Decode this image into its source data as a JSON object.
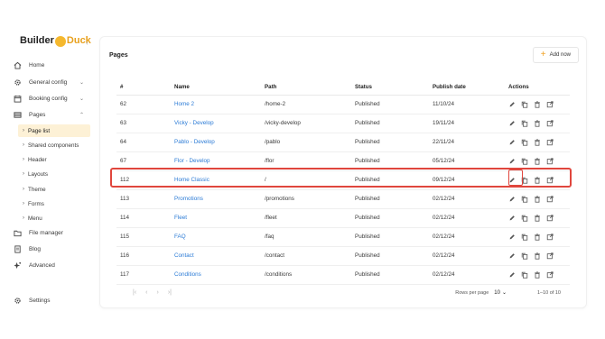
{
  "sidebar": {
    "logo_left": "Builder",
    "logo_right": "Duck",
    "collapse_glyph": "‹",
    "items": [
      {
        "label": "Home",
        "icon": "home-icon"
      },
      {
        "label": "General config",
        "icon": "gear-icon",
        "chevron": "⌄"
      },
      {
        "label": "Booking config",
        "icon": "calendar-icon",
        "chevron": "⌄"
      },
      {
        "label": "Pages",
        "icon": "pages-icon",
        "chevron": "⌃"
      }
    ],
    "sub_items": [
      {
        "label": "Page list",
        "active": true
      },
      {
        "label": "Shared components"
      },
      {
        "label": "Header"
      },
      {
        "label": "Layouts"
      },
      {
        "label": "Theme"
      },
      {
        "label": "Forms"
      },
      {
        "label": "Menu"
      }
    ],
    "bottom_items": [
      {
        "label": "File manager",
        "icon": "folder-icon"
      },
      {
        "label": "Blog",
        "icon": "document-icon"
      },
      {
        "label": "Advanced",
        "icon": "sparkle-icon"
      }
    ],
    "settings_label": "Settings",
    "sub_arrow": "›"
  },
  "main": {
    "title": "Pages",
    "add_button": "Add now",
    "add_plus": "+",
    "columns": [
      "#",
      "Name",
      "Path",
      "Status",
      "Publish date",
      "Actions"
    ],
    "rows": [
      {
        "id": "62",
        "name": "Home 2",
        "path": "/home-2",
        "status": "Published",
        "date": "11/10/24"
      },
      {
        "id": "63",
        "name": "Vicky - Develop",
        "path": "/vicky-develop",
        "status": "Published",
        "date": "19/11/24"
      },
      {
        "id": "64",
        "name": "Pablo - Develop",
        "path": "/pablo",
        "status": "Published",
        "date": "22/11/24"
      },
      {
        "id": "67",
        "name": "Flor - Develop",
        "path": "/flor",
        "status": "Published",
        "date": "05/12/24"
      },
      {
        "id": "112",
        "name": "Home Classic",
        "path": "/",
        "status": "Published",
        "date": "09/12/24"
      },
      {
        "id": "113",
        "name": "Promotions",
        "path": "/promotions",
        "status": "Published",
        "date": "02/12/24"
      },
      {
        "id": "114",
        "name": "Fleet",
        "path": "/fleet",
        "status": "Published",
        "date": "02/12/24"
      },
      {
        "id": "115",
        "name": "FAQ",
        "path": "/faq",
        "status": "Published",
        "date": "02/12/24"
      },
      {
        "id": "116",
        "name": "Contact",
        "path": "/contact",
        "status": "Published",
        "date": "02/12/24"
      },
      {
        "id": "117",
        "name": "Conditions",
        "path": "/conditions",
        "status": "Published",
        "date": "02/12/24"
      }
    ],
    "row_actions": [
      "edit-icon",
      "copy-icon",
      "delete-icon",
      "open-external-icon"
    ],
    "highlighted_row_id": "112",
    "pagination": {
      "first": "|‹",
      "prev": "‹",
      "next": "›",
      "last": "›|",
      "rows_per_page_label": "Rows per page",
      "rows_per_page_value": "10",
      "rows_per_page_chevron": "⌄",
      "range": "1–10 of 10"
    }
  },
  "colors": {
    "accent": "#f0a020",
    "link": "#2b7bd6",
    "highlight": "#e0463d",
    "active_bg": "#fdf1d6"
  }
}
